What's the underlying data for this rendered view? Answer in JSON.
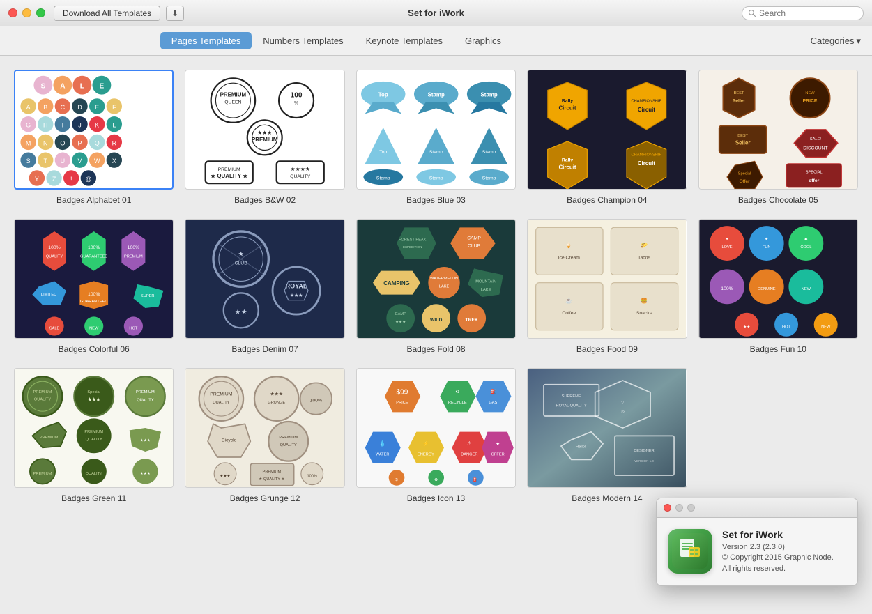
{
  "titlebar": {
    "title": "Set for iWork",
    "download_btn": "Download All Templates",
    "search_placeholder": "Search"
  },
  "nav": {
    "tabs": [
      {
        "label": "Pages Templates",
        "active": true
      },
      {
        "label": "Numbers Templates",
        "active": false
      },
      {
        "label": "Keynote Templates",
        "active": false
      },
      {
        "label": "Graphics",
        "active": false
      }
    ],
    "categories_label": "Categories"
  },
  "templates": [
    {
      "id": 1,
      "name": "Badges Alphabet 01",
      "selected": true
    },
    {
      "id": 2,
      "name": "Badges B&W 02",
      "selected": false
    },
    {
      "id": 3,
      "name": "Badges Blue 03",
      "selected": false
    },
    {
      "id": 4,
      "name": "Badges Champion 04",
      "selected": false
    },
    {
      "id": 5,
      "name": "Badges Chocolate 05",
      "selected": false
    },
    {
      "id": 6,
      "name": "Badges Colorful 06",
      "selected": false
    },
    {
      "id": 7,
      "name": "Badges Denim 07",
      "selected": false
    },
    {
      "id": 8,
      "name": "Badges Fold 08",
      "selected": false
    },
    {
      "id": 9,
      "name": "Badges Food 09",
      "selected": false
    },
    {
      "id": 10,
      "name": "Badges Fun 10",
      "selected": false
    },
    {
      "id": 11,
      "name": "Badges Green 11",
      "selected": false
    },
    {
      "id": 12,
      "name": "Badges Grunge 12",
      "selected": false
    },
    {
      "id": 13,
      "name": "Badges Icon 13",
      "selected": false
    },
    {
      "id": 14,
      "name": "Badges Modern 14",
      "selected": false
    }
  ],
  "popup": {
    "app_name": "Set for iWork",
    "version": "Version 2.3 (2.3.0)",
    "copyright": "© Copyright 2015 Graphic Node.\nAll rights reserved."
  }
}
